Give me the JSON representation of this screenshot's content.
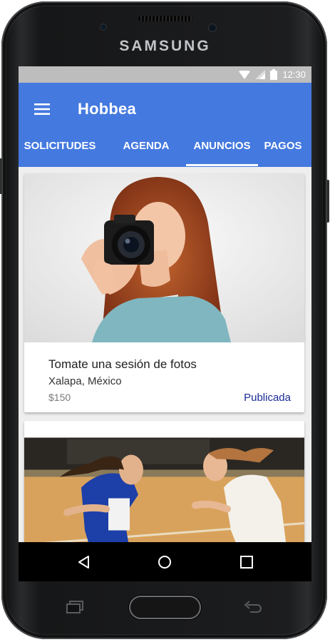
{
  "device": {
    "brand": "SAMSUNG"
  },
  "status_bar": {
    "time": "12:30",
    "icons": [
      "wifi-icon",
      "signal-icon",
      "battery-icon"
    ]
  },
  "app_bar": {
    "title": "Hobbea",
    "menu_icon": "menu-icon",
    "color": "#4479df"
  },
  "tabs": [
    {
      "label": "SOLICITUDES",
      "selected": false
    },
    {
      "label": "AGENDA",
      "selected": false
    },
    {
      "label": "ANUNCIOS",
      "selected": true
    },
    {
      "label": "PAGOS",
      "selected": false
    }
  ],
  "listings": [
    {
      "title": "Tomate una sesión de fotos",
      "location": "Xalapa, México",
      "price": "$150",
      "status": "Publicada",
      "image": "photographer-woman-camera"
    },
    {
      "image": "basketball-game"
    }
  ],
  "nav_bar": {
    "buttons": [
      "back-icon",
      "home-icon",
      "recents-icon"
    ]
  },
  "colors": {
    "accent": "#4479df",
    "status_link": "#1a2b96"
  }
}
